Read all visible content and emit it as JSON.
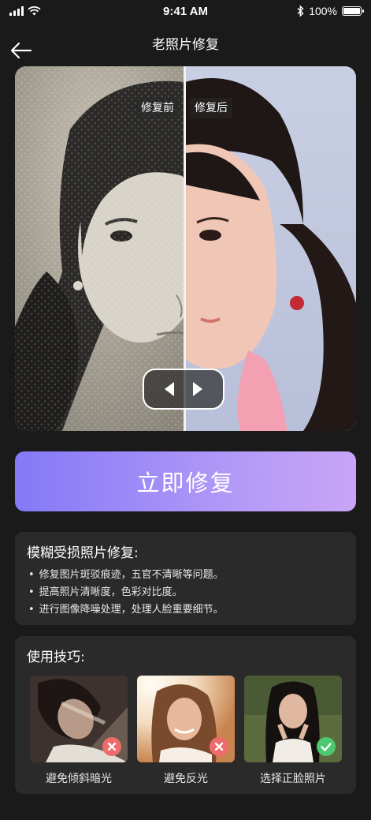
{
  "status_bar": {
    "time": "9:41 AM",
    "battery": "100%",
    "battery_level": 1.0
  },
  "nav": {
    "title": "老照片修复",
    "back_icon": "arrow-left-icon"
  },
  "compare": {
    "before_label": "修复前",
    "after_label": "修复后",
    "handle_icons": [
      "caret-left-icon",
      "caret-right-icon"
    ]
  },
  "restore_button": {
    "label": "立即修复",
    "gradient": [
      "#8579f7",
      "#c9a4f6"
    ]
  },
  "info": {
    "title": "模糊受损照片修复:",
    "items": [
      "修复图片斑驳痕迹，五官不清晰等问题。",
      "提高照片清晰度，色彩对比度。",
      "进行图像降噪处理，处理人脸重要细节。"
    ]
  },
  "tips": {
    "title": "使用技巧:",
    "items": [
      {
        "label": "避免倾斜暗光",
        "status": "bad",
        "status_icon": "close-icon",
        "status_color": "#f06b6b"
      },
      {
        "label": "避免反光",
        "status": "bad",
        "status_icon": "close-icon",
        "status_color": "#f06b6b"
      },
      {
        "label": "选择正脸照片",
        "status": "good",
        "status_icon": "check-icon",
        "status_color": "#4cc96f"
      }
    ]
  },
  "colors": {
    "background": "#1a1a1a",
    "card": "#2a2a2a"
  }
}
